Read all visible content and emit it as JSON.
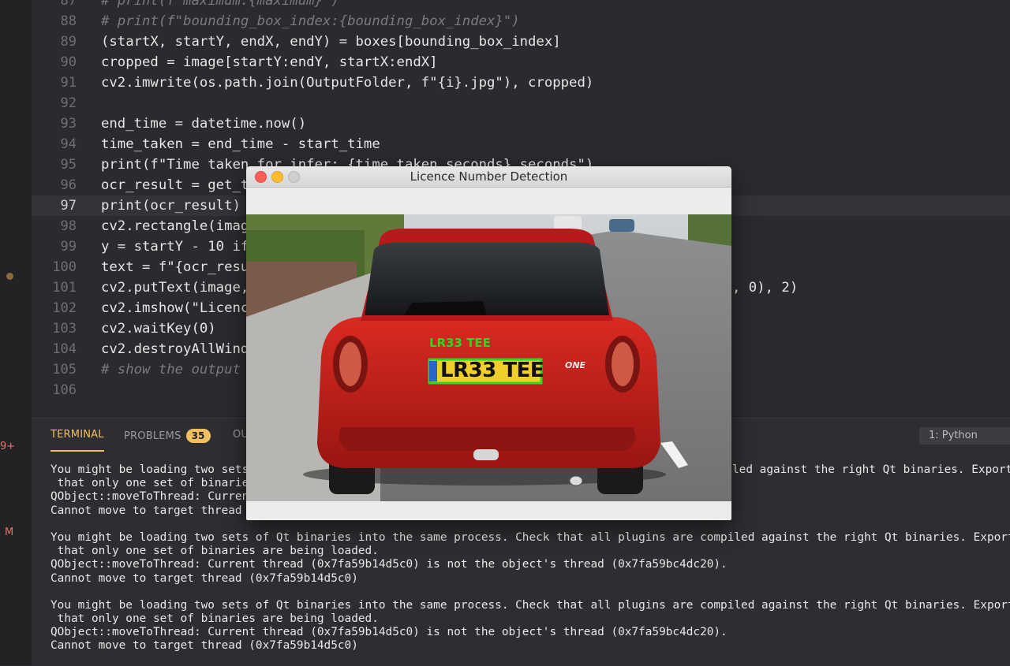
{
  "editor": {
    "current_line": "97",
    "lines": [
      {
        "num": "87",
        "text": "# print(f\"maximum:{maximum}\")"
      },
      {
        "num": "88",
        "text": "# print(f\"bounding_box_index:{bounding_box_index}\")"
      },
      {
        "num": "89",
        "text": "(startX, startY, endX, endY) = boxes[bounding_box_index]"
      },
      {
        "num": "90",
        "text": "cropped = image[startY:endY, startX:endX]"
      },
      {
        "num": "91",
        "text": "cv2.imwrite(os.path.join(OutputFolder, f\"{i}.jpg\"), cropped)"
      },
      {
        "num": "92",
        "text": ""
      },
      {
        "num": "93",
        "text": "end_time = datetime.now()"
      },
      {
        "num": "94",
        "text": "time_taken = end_time - start_time"
      },
      {
        "num": "95",
        "text": "print(f\"Time taken for infer: {time_taken.seconds} seconds\")"
      },
      {
        "num": "96",
        "text": "ocr_result = get_t"
      },
      {
        "num": "97",
        "text": "print(ocr_result)"
      },
      {
        "num": "98",
        "text": "cv2.rectangle(imag"
      },
      {
        "num": "99",
        "text": "y = startY - 10 if"
      },
      {
        "num": "100",
        "text": "text = f\"{ocr_resu"
      },
      {
        "num": "101",
        "text": "cv2.putText(image,",
        "tail": ", 0), 2)"
      },
      {
        "num": "102",
        "text": "cv2.imshow(\"Licenc"
      },
      {
        "num": "103",
        "text": "cv2.waitKey(0)"
      },
      {
        "num": "104",
        "text": "cv2.destroyAllWind"
      },
      {
        "num": "105",
        "text": "# show the output"
      },
      {
        "num": "106",
        "text": ""
      }
    ]
  },
  "sidebar": {
    "badge_top": "9+",
    "badge_bottom": "M"
  },
  "panel": {
    "tabs": {
      "terminal": "TERMINAL",
      "problems": "PROBLEMS",
      "problems_count": "35",
      "output_partial": "OU"
    },
    "terminal_select": "1: Python",
    "terminal_lines": [
      "You might be loading two sets",
      " that only one set of binarie",
      "QObject::moveToThread: Curren",
      "Cannot move to target thread",
      "",
      "You might be loading two sets of Qt binaries into the same process. Check that all plugins are compiled against the right Qt binaries. Export",
      " that only one set of binaries are being loaded.",
      "QObject::moveToThread: Current thread (0x7fa59b14d5c0) is not the object's thread (0x7fa59bc4dc20).",
      "Cannot move to target thread (0x7fa59b14d5c0)",
      "",
      "You might be loading two sets of Qt binaries into the same process. Check that all plugins are compiled against the right Qt binaries. Export",
      " that only one set of binaries are being loaded.",
      "QObject::moveToThread: Current thread (0x7fa59b14d5c0) is not the object's thread (0x7fa59bc4dc20).",
      "Cannot move to target thread (0x7fa59b14d5c0)"
    ],
    "terminal_line1_tail": "led against the right Qt binaries. Export"
  },
  "window": {
    "title": "Licence Number Detection",
    "detected_label": "LR33 TEE",
    "plate_text": "LR33 TEE",
    "car_badge": "ONE",
    "box_color": "#22dd22",
    "car_color": "#c8211c"
  }
}
